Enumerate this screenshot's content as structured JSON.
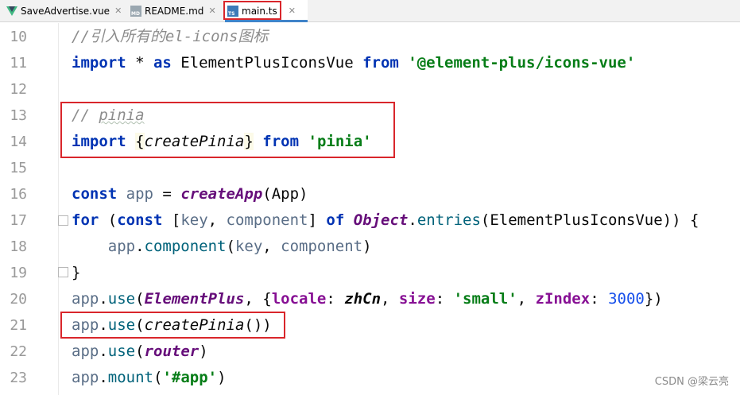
{
  "tabs": [
    {
      "label": "SaveAdvertise.vue",
      "icon": "vue-file-icon",
      "active": false
    },
    {
      "label": "README.md",
      "icon": "markdown-file-icon",
      "icon_text": "MD",
      "active": false
    },
    {
      "label": "main.ts",
      "icon": "typescript-file-icon",
      "icon_text": "TS",
      "active": true
    }
  ],
  "colors": {
    "keyword": "#0033b3",
    "string": "#067d17",
    "comment": "#8c8c8c",
    "function_italic": "#660e7a",
    "highlight_box": "#d9262b",
    "tab_active_underline": "#4083c9"
  },
  "line_numbers": [
    "10",
    "11",
    "12",
    "13",
    "14",
    "15",
    "16",
    "17",
    "18",
    "19",
    "20",
    "21",
    "22",
    "23"
  ],
  "code": {
    "l10": {
      "comment": "//引入所有的el-icons图标"
    },
    "l11": {
      "kw_import": "import",
      "star": " * ",
      "kw_as": "as",
      "name": " ElementPlusIconsVue ",
      "kw_from": "from",
      "sp": " ",
      "str": "'@element-plus/icons-vue'"
    },
    "l12": {},
    "l13": {
      "comment_prefix": "// ",
      "comment_word": "pinia"
    },
    "l14": {
      "kw_import": "import",
      "sp1": " ",
      "lbrace": "{",
      "fn": "createPinia",
      "rbrace": "}",
      "sp2": " ",
      "kw_from": "from",
      "sp3": " ",
      "str": "'pinia'"
    },
    "l15": {},
    "l16": {
      "kw_const": "const",
      "sp1": " ",
      "var": "app",
      "eq": " = ",
      "fn": "createApp",
      "args": "(App)"
    },
    "l17": {
      "kw_for": "for",
      "p1": " (",
      "kw_const": "const",
      "p2": " [",
      "v1": "key",
      "comma": ", ",
      "v2": "component",
      "p3": "] ",
      "kw_of": "of",
      "sp": " ",
      "obj": "Object",
      "dot": ".",
      "method": "entries",
      "rest": "(ElementPlusIconsVue)) {"
    },
    "l18": {
      "indent": "    ",
      "var": "app",
      "dot": ".",
      "method": "component",
      "p1": "(",
      "v1": "key",
      "comma": ", ",
      "v2": "component",
      "p2": ")"
    },
    "l19": {
      "brace": "}"
    },
    "l20": {
      "var": "app",
      "dot": ".",
      "method": "use",
      "p1": "(",
      "arg": "ElementPlus",
      "p2": ", {",
      "k1": "locale",
      "c1": ": ",
      "v1": "zhCn",
      "cm1": ", ",
      "k2": "size",
      "c2": ": ",
      "s2": "'small'",
      "cm2": ", ",
      "k3": "zIndex",
      "c3": ": ",
      "n3": "3000",
      "end": "})"
    },
    "l21": {
      "var": "app",
      "dot": ".",
      "method": "use",
      "p1": "(",
      "fn": "createPinia",
      "p2": "())"
    },
    "l22": {
      "var": "app",
      "dot": ".",
      "method": "use",
      "p1": "(",
      "arg": "router",
      "p2": ")"
    },
    "l23": {
      "var": "app",
      "dot": ".",
      "method": "mount",
      "p1": "(",
      "str": "'#app'",
      "p2": ")"
    }
  },
  "watermark": "CSDN @梁云亮"
}
